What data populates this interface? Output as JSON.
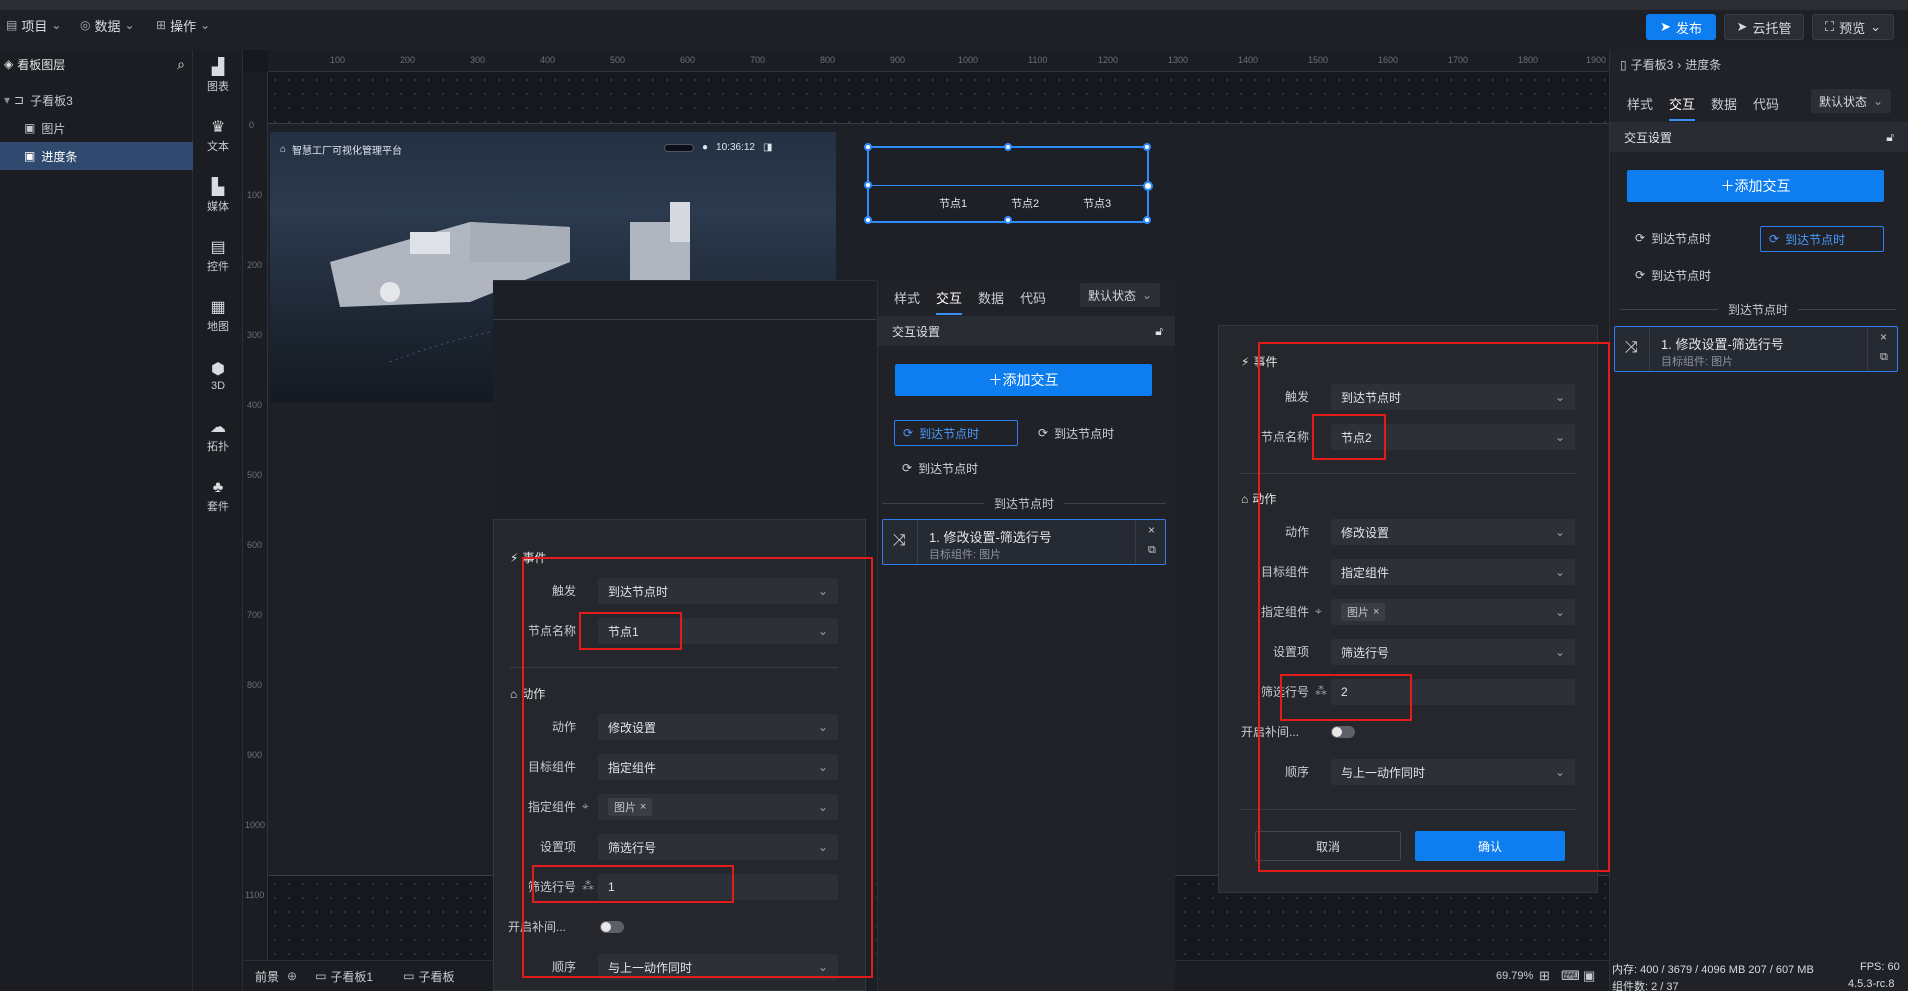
{
  "topbar": {
    "menus": [
      {
        "label": "项目",
        "icon": "file-icon"
      },
      {
        "label": "数据",
        "icon": "database-icon"
      },
      {
        "label": "操作",
        "icon": "grid-icon"
      }
    ],
    "publish_label": "发布",
    "cloud_label": "云托管",
    "preview_label": "预览"
  },
  "left_panel": {
    "title": "看板图层",
    "layers": [
      {
        "label": "子看板3"
      },
      {
        "label": "图片"
      },
      {
        "label": "进度条"
      }
    ]
  },
  "iconbar": {
    "items": [
      {
        "label": "图表",
        "icon": "chart-icon"
      },
      {
        "label": "文本",
        "icon": "text-icon"
      },
      {
        "label": "媒体",
        "icon": "media-icon"
      },
      {
        "label": "控件",
        "icon": "control-icon"
      },
      {
        "label": "地图",
        "icon": "map-icon"
      },
      {
        "label": "3D",
        "icon": "cube-icon"
      },
      {
        "label": "拓扑",
        "icon": "topology-icon"
      },
      {
        "label": "套件",
        "icon": "suite-icon"
      }
    ]
  },
  "ruler": {
    "h_ticks": [
      "100",
      "200",
      "300",
      "400",
      "500",
      "600",
      "700",
      "800",
      "900",
      "1000",
      "1100",
      "1200",
      "1300",
      "1400",
      "1500",
      "1600",
      "1700",
      "1800",
      "1900"
    ],
    "v_ticks": [
      "0",
      "100",
      "200",
      "300",
      "400",
      "500",
      "600",
      "700",
      "800",
      "900",
      "1000",
      "1100"
    ]
  },
  "canvas": {
    "image_title": "智慧工厂可视化管理平台",
    "image_time": "10:36:12",
    "progress_nodes": [
      "节点1",
      "节点2",
      "节点3"
    ]
  },
  "bottom_bar": {
    "scene_label": "前景",
    "tabs": [
      "子看板1",
      "子看板"
    ],
    "zoom": "69.79%"
  },
  "right_panel": {
    "breadcrumb": [
      "子看板3",
      "进度条"
    ],
    "tabs": [
      "样式",
      "交互",
      "数据",
      "代码"
    ],
    "state": "默认状态",
    "section_title": "交互设置",
    "add_label": "＋添加交互",
    "events": [
      "到达节点时",
      "到达节点时",
      "到达节点时"
    ],
    "group_label": "到达节点时",
    "action_title": "1. 修改设置-筛选行号",
    "action_sub": "目标组件: 图片"
  },
  "mid_panel": {
    "tabs": [
      "样式",
      "交互",
      "数据",
      "代码"
    ],
    "state": "默认状态",
    "section_title": "交互设置",
    "add_label": "＋添加交互",
    "events": [
      "到达节点时",
      "到达节点时",
      "到达节点时"
    ],
    "group_label": "到达节点时",
    "action_title": "1. 修改设置-筛选行号",
    "action_sub": "目标组件: 图片"
  },
  "dialog_left": {
    "event_header": "事件",
    "trigger_label": "触发",
    "trigger_value": "到达节点时",
    "node_label": "节点名称",
    "node_value": "节点1",
    "action_header": "动作",
    "action_label": "动作",
    "action_value": "修改设置",
    "target_label": "目标组件",
    "target_value": "指定组件",
    "specify_label": "指定组件",
    "specify_tag": "图片",
    "setting_label": "设置项",
    "setting_value": "筛选行号",
    "row_label": "筛选行号",
    "row_value": "1",
    "tween_label": "开启补间...",
    "order_label": "顺序",
    "order_value": "与上一动作同时"
  },
  "dialog_right": {
    "event_header": "事件",
    "trigger_label": "触发",
    "trigger_value": "到达节点时",
    "node_label": "节点名称",
    "node_value": "节点2",
    "action_header": "动作",
    "action_label": "动作",
    "action_value": "修改设置",
    "target_label": "目标组件",
    "target_value": "指定组件",
    "specify_label": "指定组件",
    "specify_tag": "图片",
    "setting_label": "设置项",
    "setting_value": "筛选行号",
    "row_label": "筛选行号",
    "row_value": "2",
    "tween_label": "开启补间...",
    "order_label": "顺序",
    "order_value": "与上一动作同时",
    "cancel_label": "取消",
    "confirm_label": "确认"
  },
  "status": {
    "memory": "内存: 400 / 3679 / 4096 MB 207 / 607 MB",
    "fps": "FPS: 60",
    "components": "组件数: 2 / 37",
    "version": "4.5.3-rc.8"
  },
  "colors": {
    "accent": "#0d7df0",
    "highlight": "#e21b1b",
    "panel": "#25272d"
  }
}
